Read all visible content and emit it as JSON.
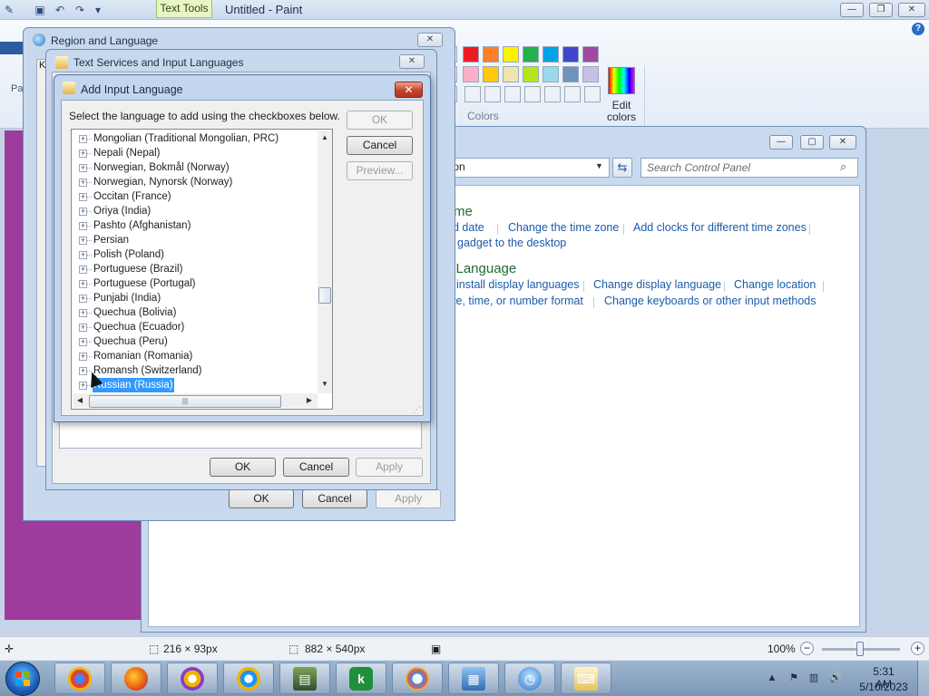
{
  "paint": {
    "title": "Untitled - Paint",
    "context_tab": "Text Tools",
    "ribbon_partial_label": "Pa",
    "edit_colors_label": "Edit colors",
    "colors_group_label": "Colors",
    "palette_row1": [
      "#ed1c24",
      "#ff7f27",
      "#fff200",
      "#22b14c",
      "#00a2e8",
      "#3f48cc",
      "#a349a4"
    ],
    "palette_row2": [
      "#ffaec9",
      "#ffc90e",
      "#efe4b0",
      "#b5e61d",
      "#99d9ea",
      "#7092be",
      "#c8bfe7"
    ],
    "status": {
      "selection_size": "216 × 93px",
      "canvas_size": "882 × 540px",
      "zoom": "100%"
    }
  },
  "control_panel": {
    "address_text": "gion",
    "search_placeholder": "Search Control Panel",
    "heading_clock": "me",
    "heading_region": "l Language",
    "links": {
      "set_date": "d date",
      "change_timezone": "Change the time zone",
      "add_clocks": "Add clocks for different time zones",
      "add_gadget": "gadget to the desktop",
      "install_display": "install display languages",
      "change_display": "Change display language",
      "change_location": "Change location",
      "change_format": "te, time, or number format",
      "change_keyboards": "Change keyboards or other input methods"
    }
  },
  "region_language": {
    "title": "Region and Language",
    "ok": "OK",
    "cancel": "Cancel",
    "apply": "Apply",
    "tab_partial": "K"
  },
  "text_services": {
    "title": "Text Services and Input Languages",
    "ok": "OK",
    "cancel": "Cancel",
    "apply": "Apply"
  },
  "add_input_language": {
    "title": "Add Input Language",
    "instruction": "Select the language to add using the checkboxes below.",
    "ok": "OK",
    "cancel": "Cancel",
    "preview": "Preview...",
    "languages": [
      "Mongolian (Traditional Mongolian, PRC)",
      "Nepali (Nepal)",
      "Norwegian, Bokmål (Norway)",
      "Norwegian, Nynorsk (Norway)",
      "Occitan (France)",
      "Oriya (India)",
      "Pashto (Afghanistan)",
      "Persian",
      "Polish (Poland)",
      "Portuguese (Brazil)",
      "Portuguese (Portugal)",
      "Punjabi (India)",
      "Quechua (Bolivia)",
      "Quechua (Ecuador)",
      "Quechua (Peru)",
      "Romanian (Romania)",
      "Romansh (Switzerland)",
      "Russian (Russia)"
    ],
    "selected_language": "Russian (Russia)"
  },
  "taskbar": {
    "apps": [
      "Google Chrome",
      "Firefox",
      "Vault",
      "Vault Search",
      "Monitor",
      "Kaspersky",
      "Paint",
      "Control Panel",
      "Region",
      "Text Services"
    ],
    "time": "5:31 AM",
    "date": "5/10/2023"
  }
}
